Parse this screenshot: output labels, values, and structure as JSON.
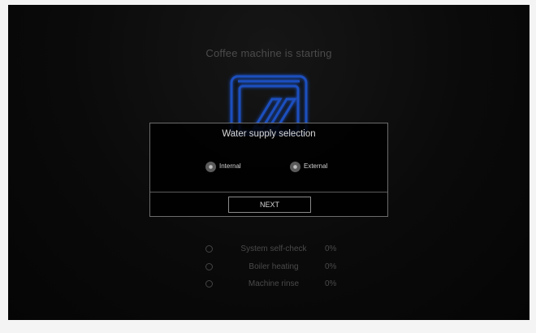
{
  "screen": {
    "title": "Coffee machine is starting",
    "machine_icon": "coffee-machine-icon"
  },
  "dialog": {
    "title": "Water supply selection",
    "options": [
      {
        "label": "Internal",
        "selected": false
      },
      {
        "label": "External",
        "selected": false
      }
    ],
    "next_label": "NEXT"
  },
  "steps": [
    {
      "label": "System self-check",
      "progress": "0%"
    },
    {
      "label": "Boiler heating",
      "progress": "0%"
    },
    {
      "label": "Machine rinse",
      "progress": "0%"
    }
  ],
  "colors": {
    "background": "#0a0a0a",
    "icon_glow": "#1f4fbf",
    "dialog_border": "#6c6c6c"
  }
}
